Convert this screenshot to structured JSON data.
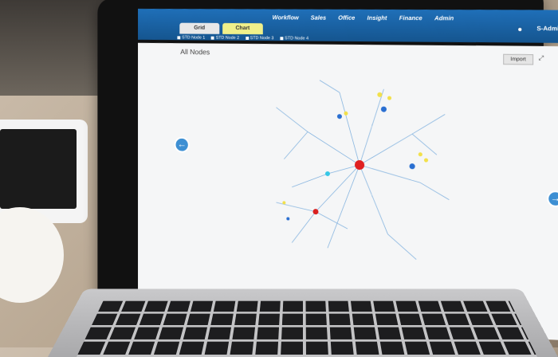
{
  "app": {
    "view_tabs": [
      "Grid",
      "Chart"
    ],
    "active_view": "Chart",
    "nav": [
      "Workflow",
      "Sales",
      "Office",
      "Insight",
      "Finance",
      "Admin"
    ],
    "user": "S-Admin",
    "node_tabs": [
      "STD Node 1",
      "STD Node 2",
      "STD Node 3",
      "STD Node 4"
    ],
    "content_title": "All Nodes",
    "import_label": "Import"
  },
  "graph": {
    "nodes": [
      {
        "id": "hub-red-main",
        "color": "#e02020"
      },
      {
        "id": "hub-red-2",
        "color": "#d92020"
      },
      {
        "id": "hub-blue-1",
        "color": "#2a6fd1"
      },
      {
        "id": "hub-blue-2",
        "color": "#2a6fd1"
      },
      {
        "id": "hub-blue-3",
        "color": "#2a6fd1"
      },
      {
        "id": "hub-cyan",
        "color": "#35c7e6"
      }
    ]
  }
}
